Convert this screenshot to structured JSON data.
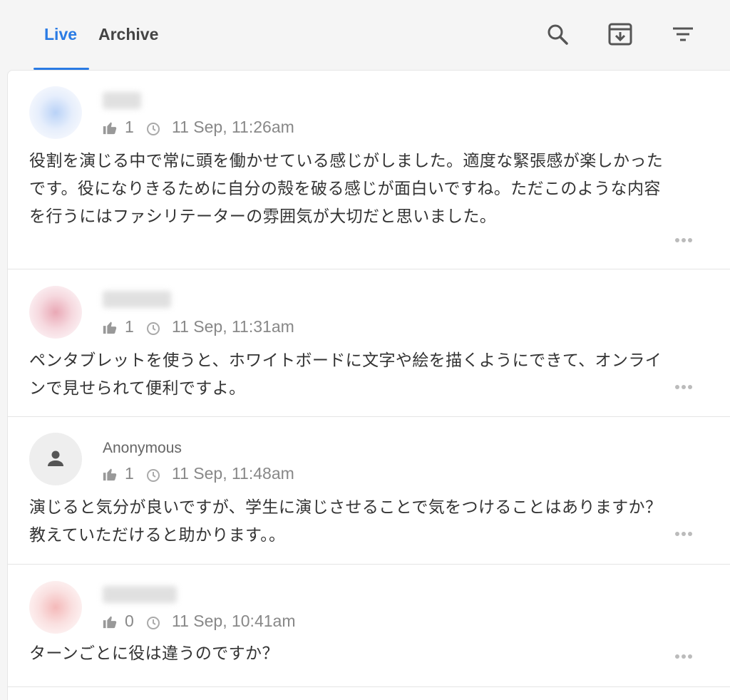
{
  "tabs": {
    "live": "Live",
    "archive": "Archive"
  },
  "icons": {
    "search": "search-icon",
    "archive": "archive-download-icon",
    "filter": "filter-icon"
  },
  "colors": {
    "accent": "#2a7be4",
    "text": "#333333",
    "meta": "#888888"
  },
  "posts": [
    {
      "author": "",
      "likes": "1",
      "time": "11 Sep, 11:26am",
      "text": "役割を演じる中で常に頭を働かせている感じがしました。適度な緊張感が楽しかったです。役になりきるために自分の殻を破る感じが面白いですね。ただこのような内容を行うにはファシリテーターの雰囲気が大切だと思いました。"
    },
    {
      "author": "",
      "likes": "1",
      "time": "11 Sep, 11:31am",
      "text": "ペンタブレットを使うと、ホワイトボードに文字や絵を描くようにできて、オンラインで見せられて便利ですよ。"
    },
    {
      "author": "Anonymous",
      "likes": "1",
      "time": "11 Sep, 11:48am",
      "text": "演じると気分が良いですが、学生に演じさせることで気をつけることはありますか？教えていただけると助かります。。"
    },
    {
      "author": "",
      "likes": "0",
      "time": "11 Sep, 10:41am",
      "text": "ターンごとに役は違うのですか？"
    }
  ]
}
